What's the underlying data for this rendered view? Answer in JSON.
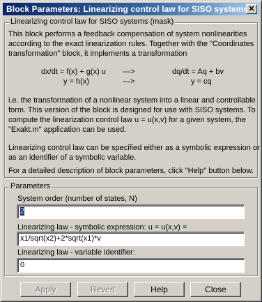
{
  "window": {
    "title": "Block Parameters: Linearizing control law for SISO systems",
    "close_glyph": "✕"
  },
  "description": {
    "legend": "Linearizing control law for SISO systems (mask)",
    "para1": [
      "This block performs a feedback compensation of system nonlinearities",
      "according to the exact linearization rules. Together with the \"Coordinates",
      "transformation\" block, it implements a transformation"
    ],
    "equations": {
      "left1": "dx/dt = f(x) + g(x) u",
      "arrow1": "--->",
      "right1": "dq/dt = Aq + bv",
      "left2": "y = h(x)",
      "arrow2": "--->",
      "right2": "y = cq"
    },
    "para2": [
      "i.e. the transformation of a nonlinear system into a linear and controllable",
      "form. This version of the block is designed for use with SISO systems. To",
      "compute the linearization control law u = u(x,v) for a given system, the",
      "\"Exakt.m\" application can be used."
    ],
    "para3": [
      "Linearizing control law can be specified either as a symbolic expression or",
      "as an identifier of a symbolic variable."
    ],
    "para4": "For a detailed description of block parameters, click \"Help\" button below."
  },
  "parameters": {
    "legend": "Parameters",
    "system_order": {
      "label": "System order (number of states, N)",
      "value": "2"
    },
    "symbolic_law": {
      "label": "Linearizing law - symbolic expression: u = u(x,v) =",
      "value": "x1/sqrt(x2)+2*sqrt(x1)*v"
    },
    "variable_id": {
      "label": "Linearizing law - variable identifier:",
      "value": "0"
    }
  },
  "buttons": {
    "apply": "Apply",
    "revert": "Revert",
    "help": "Help",
    "close": "Close"
  },
  "colors": {
    "titlebar_start": "#0a246a",
    "titlebar_end": "#a6caf0",
    "dialog_bg": "#d4d0c8"
  }
}
